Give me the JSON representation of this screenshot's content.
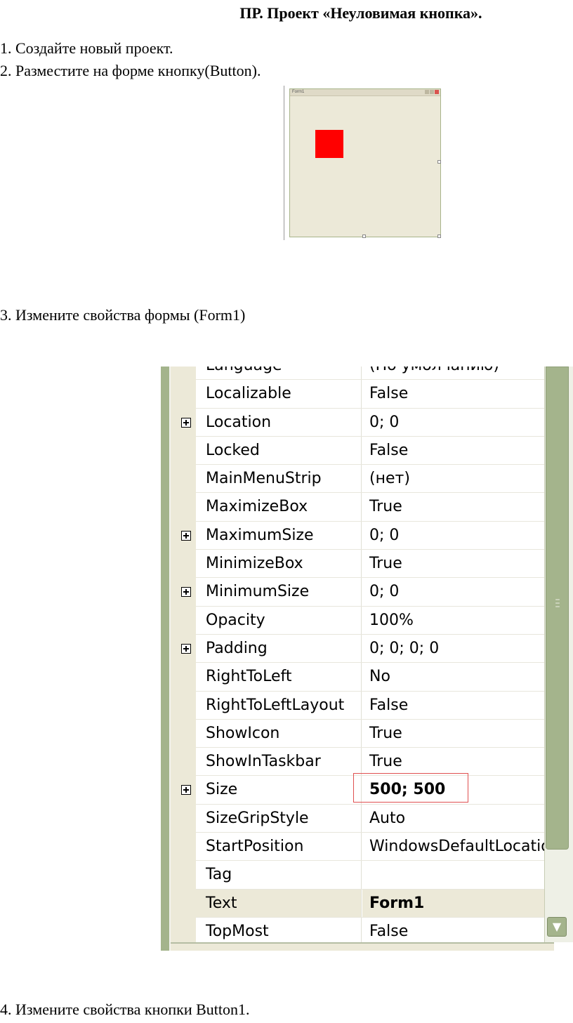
{
  "document": {
    "title": "ПР. Проект «Неуловимая кнопка».",
    "steps": [
      "1. Создайте новый проект.",
      "2. Разместите на форме кнопку(Button).",
      "3. Измените свойства формы (Form1)",
      "4. Измените свойства кнопки Button1."
    ]
  },
  "form_preview": {
    "caption": "Form1",
    "button_color": "#ff0000"
  },
  "property_grid": {
    "rows": [
      {
        "name": "Language",
        "value": "(По умолчанию)",
        "expandable": false
      },
      {
        "name": "Localizable",
        "value": "False",
        "expandable": false
      },
      {
        "name": "Location",
        "value": "0; 0",
        "expandable": true
      },
      {
        "name": "Locked",
        "value": "False",
        "expandable": false
      },
      {
        "name": "MainMenuStrip",
        "value": "(нет)",
        "expandable": false
      },
      {
        "name": "MaximizeBox",
        "value": "True",
        "expandable": false
      },
      {
        "name": "MaximumSize",
        "value": "0; 0",
        "expandable": true
      },
      {
        "name": "MinimizeBox",
        "value": "True",
        "expandable": false
      },
      {
        "name": "MinimumSize",
        "value": "0; 0",
        "expandable": true
      },
      {
        "name": "Opacity",
        "value": "100%",
        "expandable": false
      },
      {
        "name": "Padding",
        "value": "0; 0; 0; 0",
        "expandable": true
      },
      {
        "name": "RightToLeft",
        "value": "No",
        "expandable": false
      },
      {
        "name": "RightToLeftLayout",
        "value": "False",
        "expandable": false
      },
      {
        "name": "ShowIcon",
        "value": "True",
        "expandable": false
      },
      {
        "name": "ShowInTaskbar",
        "value": "True",
        "expandable": false
      },
      {
        "name": "Size",
        "value": "500; 500",
        "expandable": true,
        "bold": true
      },
      {
        "name": "SizeGripStyle",
        "value": "Auto",
        "expandable": false
      },
      {
        "name": "StartPosition",
        "value": "WindowsDefaultLocation",
        "expandable": false
      },
      {
        "name": "Tag",
        "value": "",
        "expandable": false
      },
      {
        "name": "Text",
        "value": "Form1",
        "expandable": false,
        "bold": true,
        "selected": true
      },
      {
        "name": "TopMost",
        "value": "False",
        "expandable": false
      }
    ],
    "scroll_down_icon": "chevron-down-icon",
    "highlight_color": "#e05050"
  }
}
